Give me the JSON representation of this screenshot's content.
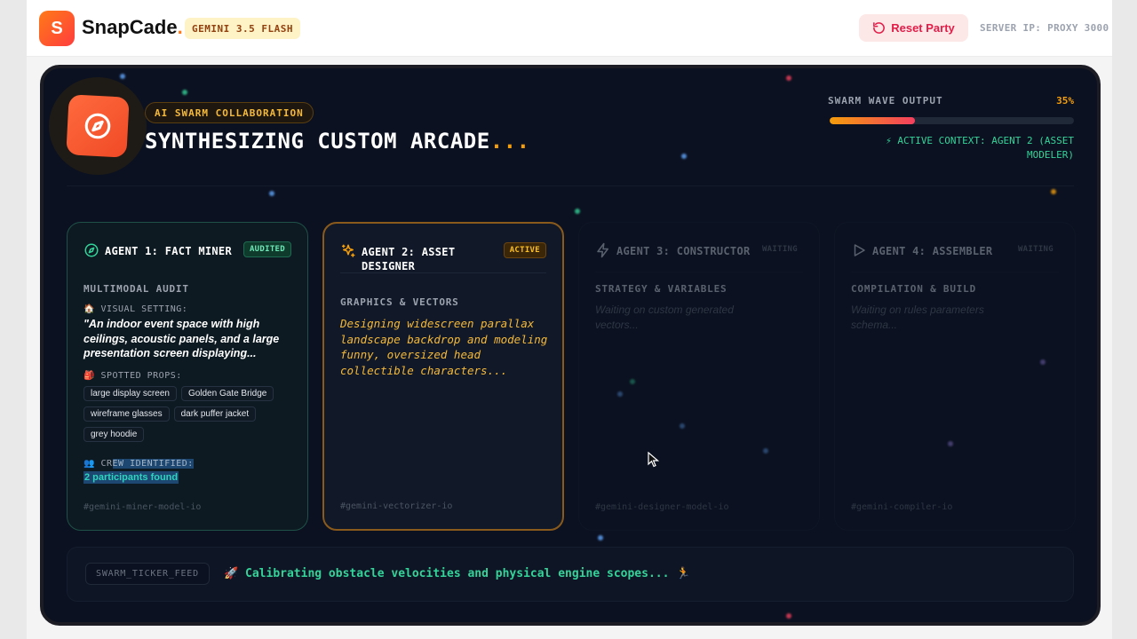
{
  "header": {
    "logo_letter": "S",
    "brand_name": "SnapCade",
    "brand_dot": ".",
    "model_badge": "GEMINI 3.5 FLASH",
    "reset_label": "Reset Party",
    "server_ip": "SERVER IP: PROXY 3000"
  },
  "hero": {
    "tag": "AI SWARM COLLABORATION",
    "title": "SYNTHESIZING CUSTOM ARCADE",
    "title_ellipsis": "...",
    "wave_label": "SWARM WAVE OUTPUT",
    "wave_percent_text": "35%",
    "wave_progress": 0.35,
    "active_context": "⚡ ACTIVE CONTEXT: AGENT 2 (ASSET MODELER)"
  },
  "agents": [
    {
      "title": "AGENT 1: FACT MINER",
      "badge": "AUDITED",
      "section": "MULTIMODAL AUDIT",
      "visual_label": "🏠 VISUAL SETTING:",
      "visual_quote": "\"An indoor event space with high ceilings, acoustic panels, and a large presentation screen displaying...",
      "props_label": "🎒 SPOTTED PROPS:",
      "props": [
        "large display screen",
        "Golden Gate Bridge",
        "wireframe glasses",
        "dark puffer jacket",
        "grey hoodie"
      ],
      "crew_label_prefix": "👥 CR",
      "crew_label_highlight": "EW IDENTIFIED:",
      "crew_value": "2 participants found",
      "footer": "#gemini-miner-model-io"
    },
    {
      "title": "AGENT 2: ASSET DESIGNER",
      "badge": "ACTIVE",
      "section": "GRAPHICS & VECTORS",
      "body": "Designing widescreen parallax landscape backdrop and modeling funny, oversized head collectible characters...",
      "footer": "#gemini-vectorizer-io"
    },
    {
      "title": "AGENT 3: CONSTRUCTOR",
      "badge": "WAITING",
      "section": "STRATEGY & VARIABLES",
      "body": "Waiting on custom generated vectors...",
      "footer": "#gemini-designer-model-io"
    },
    {
      "title": "AGENT 4: ASSEMBLER",
      "badge": "WAITING",
      "section": "COMPILATION & BUILD",
      "body": "Waiting on rules parameters schema...",
      "footer": "#gemini-compiler-io"
    }
  ],
  "ticker": {
    "tag": "SWARM_TICKER_FEED",
    "message": "🚀 Calibrating obstacle velocities and physical engine scopes... 🏃"
  },
  "colors": {
    "accent_orange": "#f59e0b",
    "accent_green": "#34d399",
    "reset_red": "#e11d48",
    "panel_bg": "#0b1120"
  },
  "icons": {
    "hero": "compass-icon",
    "agent1": "compass-icon",
    "agent2": "sparkles-icon",
    "agent3": "zap-icon",
    "agent4": "play-icon",
    "reset": "rotate-ccw-icon"
  }
}
